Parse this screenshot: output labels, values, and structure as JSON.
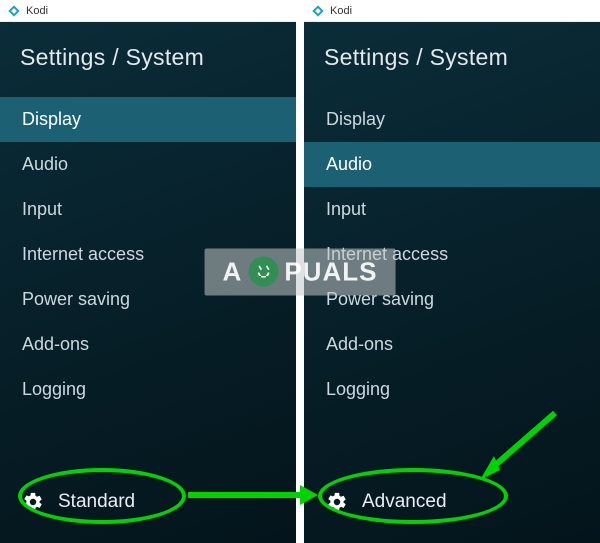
{
  "app_name": "Kodi",
  "heading": "Settings / System",
  "menu": {
    "items": [
      {
        "label": "Display"
      },
      {
        "label": "Audio"
      },
      {
        "label": "Input"
      },
      {
        "label": "Internet access"
      },
      {
        "label": "Power saving"
      },
      {
        "label": "Add-ons"
      },
      {
        "label": "Logging"
      }
    ]
  },
  "left_panel": {
    "selected_index": 0,
    "level_label": "Standard"
  },
  "right_panel": {
    "selected_index": 1,
    "level_label": "Advanced"
  },
  "watermark": {
    "prefix": "A",
    "suffix": "PUALS"
  },
  "colors": {
    "annotation": "#00d400",
    "selected_bg": "#1b6173"
  }
}
